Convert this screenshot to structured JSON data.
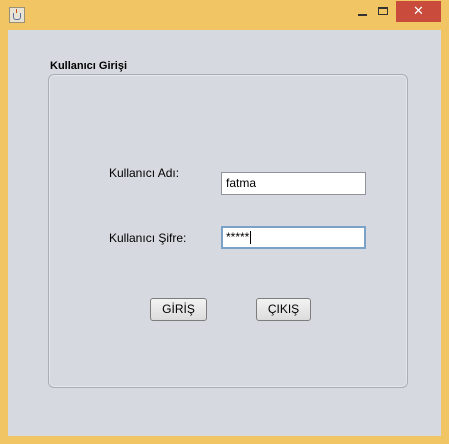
{
  "window": {
    "title": "",
    "controls": {
      "minimize": "",
      "maximize": "",
      "close": "✕"
    }
  },
  "panel": {
    "title": "Kullanıcı Girişi"
  },
  "form": {
    "username_label": "Kullanıcı Adı:",
    "username_value": "fatma",
    "password_label": "Kullanıcı Şifre:",
    "password_value": "*****"
  },
  "buttons": {
    "login": "GİRİŞ",
    "exit": "ÇIKIŞ"
  },
  "colors": {
    "frame": "#f2c564",
    "close": "#c94b3c",
    "background": "#d6d9df",
    "focus": "#7aa3c7"
  },
  "icons": {
    "app": "java-cup-icon",
    "minimize": "minimize-icon",
    "maximize": "maximize-icon",
    "close": "close-icon"
  }
}
